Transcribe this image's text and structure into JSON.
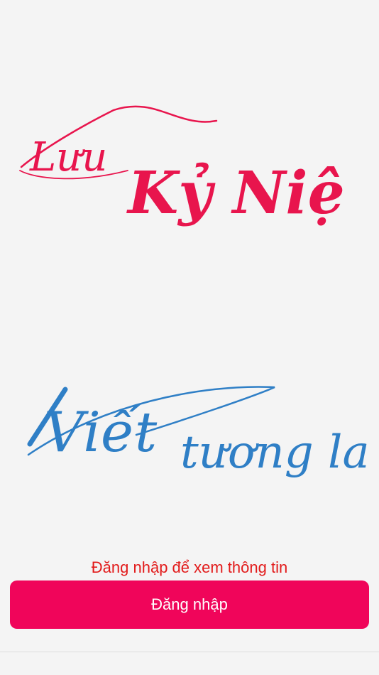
{
  "logos": {
    "top": {
      "line1": "Lưu",
      "line2": "Kỷ Niệm",
      "color": "#e8154d"
    },
    "bottom": {
      "line1": "Viết",
      "line2": "tương lai",
      "color": "#2f7fc6"
    }
  },
  "login": {
    "prompt": "Đăng nhập để xem thông tin",
    "prompt_color": "#e21b1b",
    "button_label": "Đăng nhập",
    "button_color": "#f0055a"
  }
}
